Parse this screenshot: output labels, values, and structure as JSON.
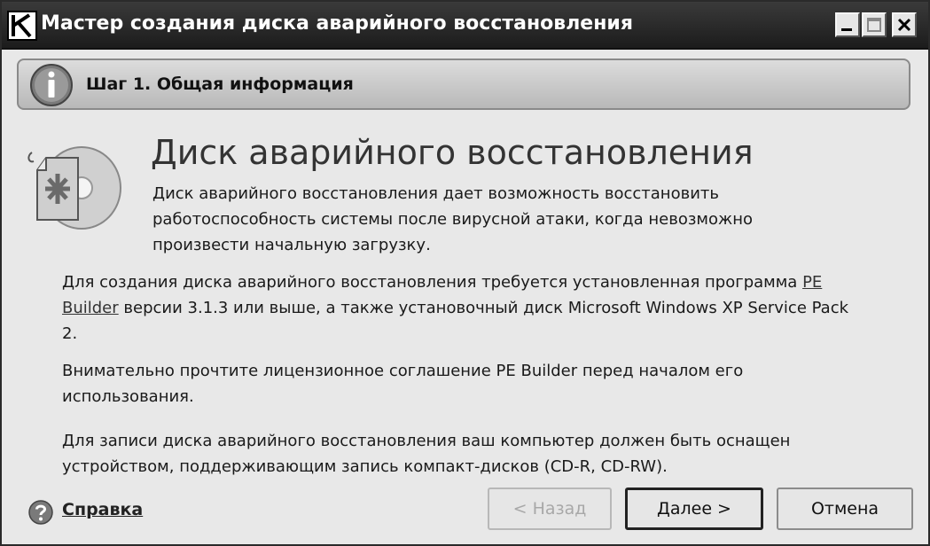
{
  "window": {
    "title": "Мастер создания диска аварийного восстановления",
    "controls": [
      "minimize",
      "maximize",
      "close"
    ]
  },
  "step": {
    "title": "Шаг 1. Общая информация",
    "icon": "info-icon"
  },
  "hero": {
    "icon": "rescue-disk-icon",
    "title": "Диск аварийного восстановления",
    "description": "Диск аварийного восстановления дает возможность восстановить работоспособность системы после вирусной атаки, когда невозможно произвести начальную загрузку."
  },
  "paragraphs": {
    "p1_before": "Для создания диска аварийного восстановления требуется установленная программа ",
    "p1_link": "PE Builder",
    "p1_after": " версии 3.1.3 или выше, а также установочный диск Microsoft Windows XP Service Pack 2.",
    "p2": "Внимательно прочтите лицензионное соглашение PE Builder перед началом его использования.",
    "p3": "Для записи диска аварийного восстановления ваш компьютер должен быть оснащен устройством, поддерживающим запись компакт-дисков (CD-R, CD-RW)."
  },
  "footer": {
    "help_label": "Справка",
    "back_label": "< Назад",
    "next_label": "Далее >",
    "cancel_label": "Отмена"
  }
}
